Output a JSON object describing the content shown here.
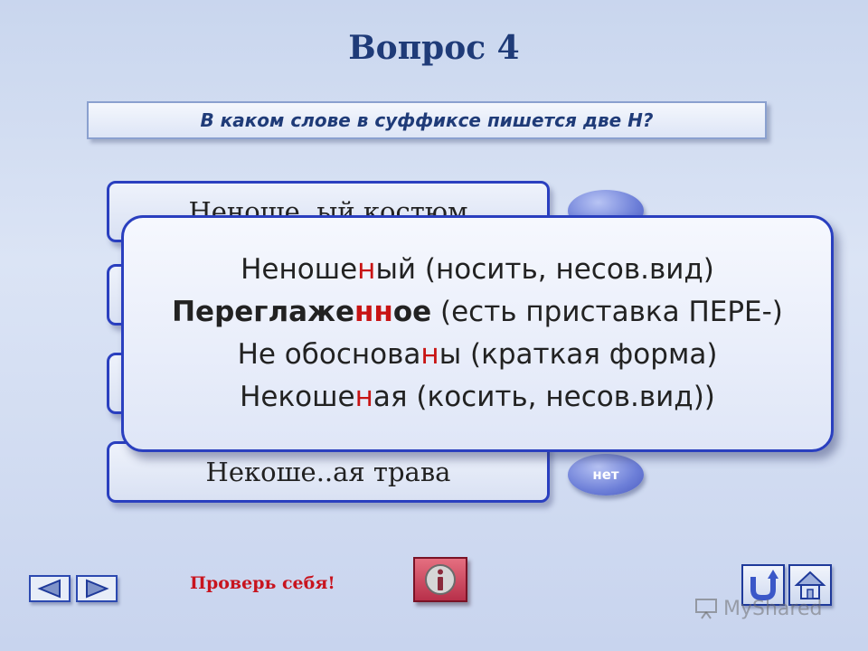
{
  "title": "Вопрос 4",
  "question": "В каком слове в суффиксе пишется две Н?",
  "answers": [
    {
      "label": "Неноше..ый костюм"
    },
    {
      "label": ""
    },
    {
      "label": ""
    },
    {
      "label": "Некоше..ая трава"
    }
  ],
  "ovals": {
    "first": "",
    "last": "нет"
  },
  "explanation": {
    "line1": {
      "a": "Неноше",
      "b": "н",
      "c": "ый (носить, несов.вид)"
    },
    "line2": {
      "a": "Переглаже",
      "b": "нн",
      "c": "ое",
      "d": " (есть приставка ПЕРЕ-)"
    },
    "line3": {
      "a": "Не обоснова",
      "b": "н",
      "c": "ы (краткая форма)"
    },
    "line4": {
      "a": "Некоше",
      "b": "н",
      "c": "ая (косить, несов.вид))"
    }
  },
  "footer": {
    "check_label": "Проверь себя!",
    "watermark": "MyShared"
  },
  "icons": {
    "prev": "arrow-left-icon",
    "next": "arrow-right-icon",
    "info": "info-icon",
    "back": "u-turn-icon",
    "home": "home-icon"
  },
  "colors": {
    "accent": "#2a3fbf",
    "title": "#1f3b78",
    "highlight": "#c81414",
    "info_button": "#c8405a"
  }
}
